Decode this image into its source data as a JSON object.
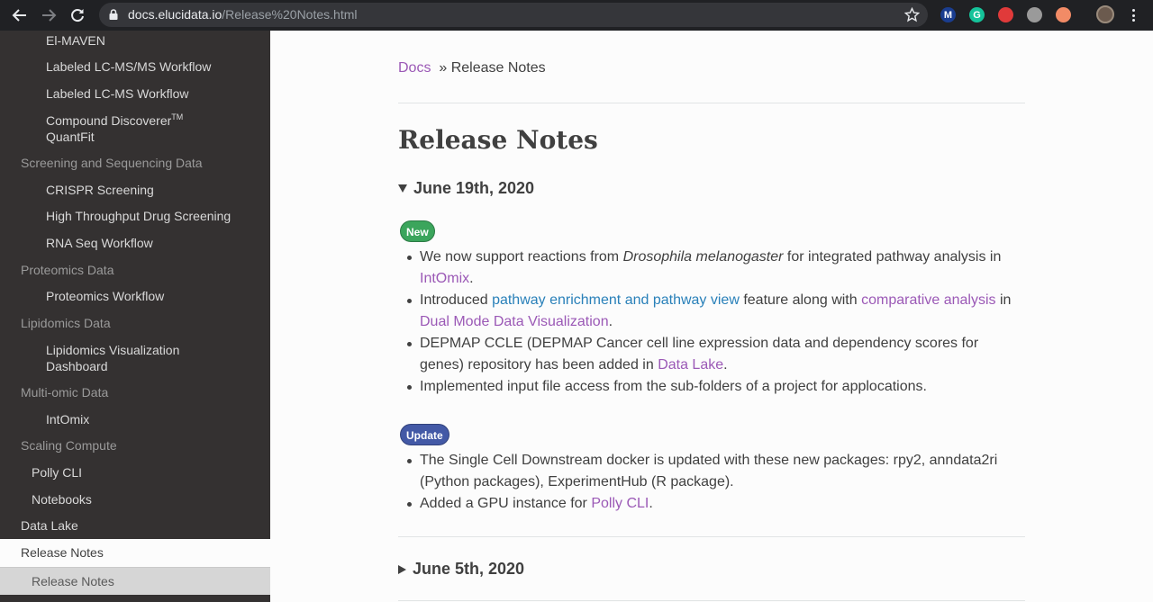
{
  "browser": {
    "url_host": "docs.elucidata.io",
    "url_path": "/Release%20Notes.html",
    "extensions": [
      {
        "name": "m-extension-icon",
        "letter": "M",
        "color": "#1a3d8f"
      },
      {
        "name": "grammarly-icon",
        "letter": "G",
        "color": "#15c39a"
      },
      {
        "name": "red-swirl-extension-icon",
        "letter": "",
        "color": "#e03a3a"
      },
      {
        "name": "gray-extension-icon",
        "letter": "",
        "color": "#9a9a9a"
      },
      {
        "name": "orange-extension-icon",
        "letter": "",
        "color": "#f28b66"
      }
    ]
  },
  "sidebar": {
    "items": [
      {
        "label": "El-MAVEN",
        "level": "l3"
      },
      {
        "label": "Labeled LC-MS/MS Workflow",
        "level": "l3"
      },
      {
        "label": "Labeled LC-MS Workflow",
        "level": "l3"
      },
      {
        "label": "Compound Discoverer",
        "sup": "TM",
        "label2": "QuantFit",
        "level": "l3"
      },
      {
        "label": "Screening and Sequencing Data",
        "level": "cat"
      },
      {
        "label": "CRISPR Screening",
        "level": "l3"
      },
      {
        "label": "High Throughput Drug Screening",
        "level": "l3"
      },
      {
        "label": "RNA Seq Workflow",
        "level": "l3"
      },
      {
        "label": "Proteomics Data",
        "level": "cat"
      },
      {
        "label": "Proteomics Workflow",
        "level": "l3"
      },
      {
        "label": "Lipidomics Data",
        "level": "cat"
      },
      {
        "label": "Lipidomics Visualization",
        "label2": "Dashboard",
        "level": "l3"
      },
      {
        "label": "Multi-omic Data",
        "level": "cat"
      },
      {
        "label": "IntOmix",
        "level": "l3"
      },
      {
        "label": "Scaling Compute",
        "level": "cat"
      },
      {
        "label": "Polly CLI",
        "level": "l2"
      },
      {
        "label": "Notebooks",
        "level": "l2"
      },
      {
        "label": "Data Lake",
        "level": "l1"
      },
      {
        "label": "Release Notes",
        "level": "active"
      },
      {
        "label": "Release Notes",
        "level": "active-sub"
      }
    ]
  },
  "breadcrumb": {
    "home": "Docs",
    "separator": "»",
    "current": "Release Notes"
  },
  "page_title": "Release Notes",
  "sections": [
    {
      "date": "June 19th, 2020",
      "expanded": true,
      "new_badge": "New",
      "new_items": {
        "item1": {
          "pre": "We now support reactions from ",
          "em": "Drosophila melanogaster",
          "post": " for integrated pathway analysis in ",
          "link": "IntOmix",
          "end": "."
        },
        "item2": {
          "pre": "Introduced ",
          "link1": "pathway enrichment and pathway view",
          "mid": " feature along with ",
          "link2": "comparative analysis",
          "mid2": " in ",
          "link3": "Dual Mode Data Visualization",
          "end": "."
        },
        "item3": {
          "pre": "DEPMAP CCLE (DEPMAP Cancer cell line expression data and dependency scores for genes) repository has been added in ",
          "link": "Data Lake",
          "end": "."
        },
        "item4": {
          "text": "Implemented input file access from the sub-folders of a project for applocations."
        }
      },
      "update_badge": "Update",
      "update_items": {
        "item1": {
          "text": "The Single Cell Downstream docker is updated with these new packages: rpy2, anndata2ri (Python packages), ExperimentHub (R package)."
        },
        "item2": {
          "pre": "Added a GPU instance for ",
          "link": "Polly CLI",
          "end": "."
        }
      }
    },
    {
      "date": "June 5th, 2020",
      "expanded": false
    }
  ]
}
